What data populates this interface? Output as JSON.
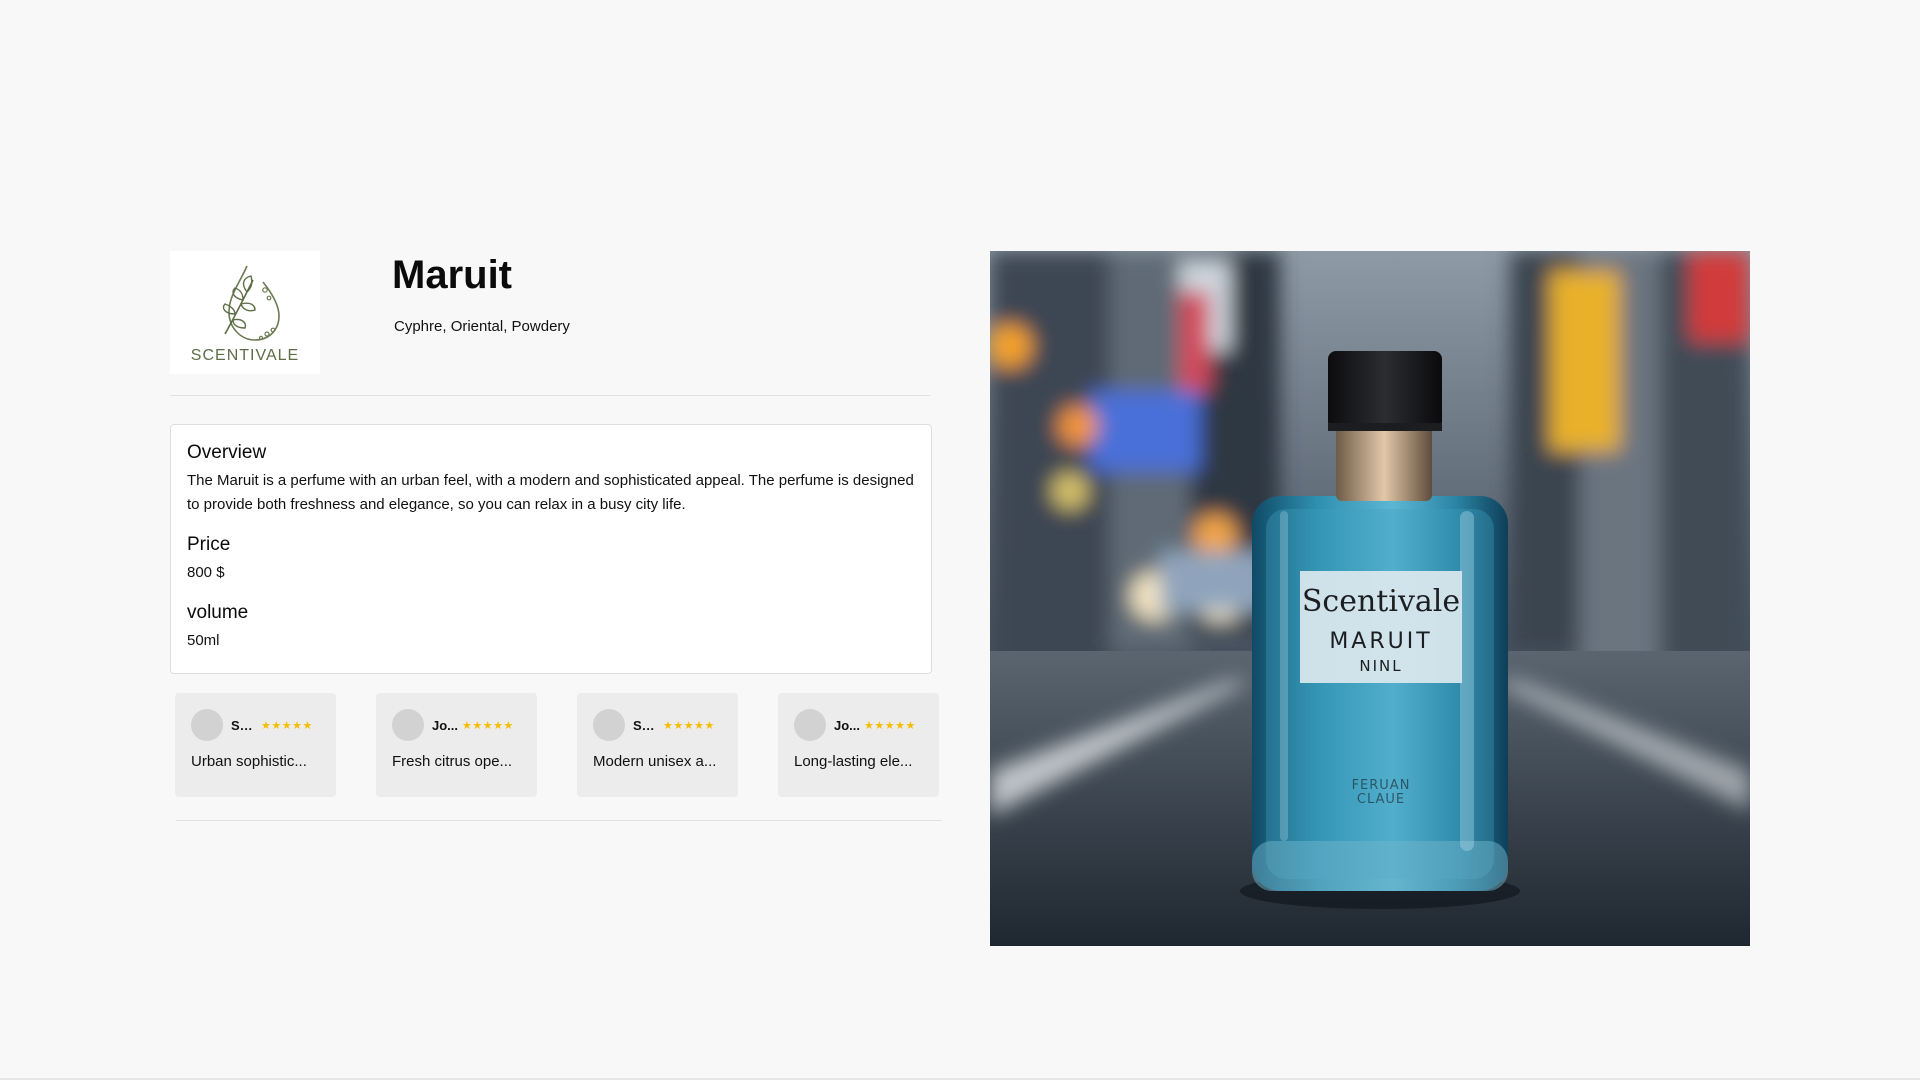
{
  "brand": {
    "logo_text": "SCENTIVALE",
    "logo_icon": "leaf-drop-icon"
  },
  "product": {
    "name": "Maruit",
    "notes": "Cyphre, Oriental, Powdery"
  },
  "details": {
    "overview_label": "Overview",
    "overview_text": "The Maruit is a perfume with an urban feel, with a modern and sophisticated appeal. The perfume is designed to provide both freshness and elegance, so you can relax in a busy city life.",
    "price_label": "Price",
    "price_value": "800 $",
    "volume_label": "volume",
    "volume_value": "50ml"
  },
  "reviews": [
    {
      "name": "So...",
      "stars": "★★★★★",
      "rating": 5,
      "text": "Urban sophistic..."
    },
    {
      "name": "Jo...",
      "stars": "★★★★★",
      "rating": 5,
      "text": "Fresh citrus ope..."
    },
    {
      "name": "So...",
      "stars": "★★★★★",
      "rating": 5,
      "text": "Modern unisex a..."
    },
    {
      "name": "Jo...",
      "stars": "★★★★★",
      "rating": 5,
      "text": "Long-lasting ele..."
    }
  ],
  "image": {
    "label_brand": "Scentivale",
    "label_name": "MARUIT",
    "label_sub": "NINL",
    "bottle_engraving_line1": "FERUAN",
    "bottle_engraving_line2": "CLAUE"
  },
  "colors": {
    "background": "#f8f8f8",
    "star": "#f5bd00",
    "review_card": "#ececec",
    "logo_green": "#5d6e47",
    "bottle_blue": "#2f8fae"
  }
}
